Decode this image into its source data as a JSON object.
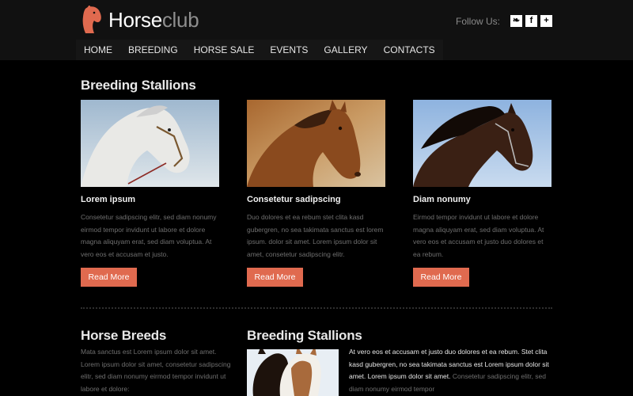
{
  "logo": {
    "word1": "Horse",
    "word2": "club"
  },
  "follow": {
    "label": "Follow Us:",
    "icons": [
      "twitter-icon",
      "facebook-icon",
      "plus-icon"
    ],
    "glyphs": [
      "❧",
      "f",
      "+"
    ]
  },
  "nav": {
    "items": [
      "HOME",
      "BREEDING",
      "HORSE SALE",
      "EVENTS",
      "GALLERY",
      "CONTACTS"
    ]
  },
  "sections": {
    "breeding_title": "Breeding Stallions",
    "breeds_title": "Horse Breeds",
    "bottom_title": "Breeding Stallions"
  },
  "cards": [
    {
      "title": "Lorem ipsum",
      "text": "Consetetur sadipscing elitr, sed diam nonumy eirmod tempor invidunt ut labore et dolore magna aliquyam erat, sed diam voluptua. At vero eos et accusam et justo.",
      "button": "Read More"
    },
    {
      "title": "Consetetur sadipscing",
      "text": "Duo dolores et ea rebum stet clita kasd gubergren, no sea takimata sanctus est lorem ipsum.  dolor sit amet. Lorem ipsum dolor sit amet, consetetur sadipscing elitr.",
      "button": "Read More"
    },
    {
      "title": "Diam nonumy",
      "text": "Eirmod tempor invidunt ut labore et dolore magna aliquyam erat, sed diam voluptua. At vero eos et accusam et justo duo dolores et ea rebum.",
      "button": "Read More"
    }
  ],
  "breeds": {
    "text": "Mata sanctus est Lorem ipsum dolor sit amet. Lorem ipsum dolor sit amet, consetetur sadipscing elitr, sed diam nonumy eirmod tempor invidunt ut labore et dolore:"
  },
  "bottom": {
    "lead": "At vero eos et accusam et justo duo dolores et ea rebum. Stet clita kasd gubergren, no sea takimata sanctus est Lorem ipsum dolor sit amet. Lorem ipsum dolor sit amet.",
    "rest": "Consetetur sadipscing elitr, sed diam nonumy eirmod tempor"
  },
  "colors": {
    "accent": "#e06a4f",
    "background": "#000000",
    "header": "#111111",
    "muted_text": "#6f6f6f"
  }
}
